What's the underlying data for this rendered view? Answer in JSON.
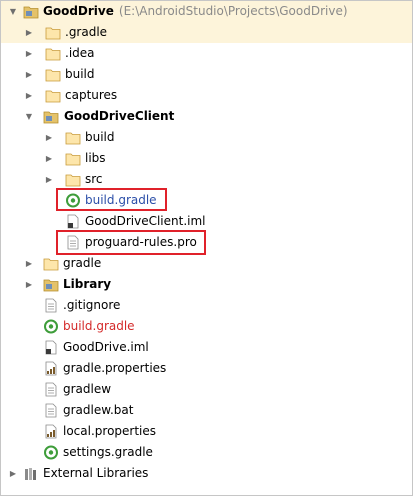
{
  "tree": {
    "root": {
      "label": "GoodDrive",
      "path": "(E:\\AndroidStudio\\Projects\\GoodDrive)"
    },
    "items": [
      {
        "label": ".gradle"
      },
      {
        "label": ".idea"
      },
      {
        "label": "build"
      },
      {
        "label": "captures"
      },
      {
        "label": "GoodDriveClient"
      },
      {
        "label": "build"
      },
      {
        "label": "libs"
      },
      {
        "label": "src"
      },
      {
        "label": "build.gradle"
      },
      {
        "label": "GoodDriveClient.iml"
      },
      {
        "label": "proguard-rules.pro"
      },
      {
        "label": "gradle"
      },
      {
        "label": "Library"
      },
      {
        "label": ".gitignore"
      },
      {
        "label": "build.gradle"
      },
      {
        "label": "GoodDrive.iml"
      },
      {
        "label": "gradle.properties"
      },
      {
        "label": "gradlew"
      },
      {
        "label": "gradlew.bat"
      },
      {
        "label": "local.properties"
      },
      {
        "label": "settings.gradle"
      },
      {
        "label": "External Libraries"
      }
    ]
  },
  "colors": {
    "folder": "#e4c26a",
    "gradle_green": "#3e9d3a",
    "highlight_box": "#e0212a",
    "selected_row": "#fdf4da",
    "red_text": "#d42a2a",
    "blue_text": "#2b4ea8"
  },
  "icons": [
    "folder-icon",
    "module-folder-icon",
    "gradle-icon",
    "file-icon",
    "properties-icon",
    "libraries-icon"
  ]
}
